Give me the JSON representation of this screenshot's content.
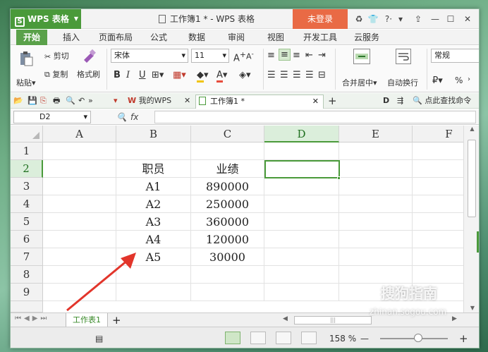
{
  "app": {
    "logo_label": "WPS 表格",
    "window_title": "工作簿1 * - WPS 表格",
    "login_label": "未登录"
  },
  "ribbon_tabs": [
    "开始",
    "插入",
    "页面布局",
    "公式",
    "数据",
    "审阅",
    "视图",
    "开发工具",
    "云服务"
  ],
  "ribbon": {
    "paste": "粘贴",
    "cut": "剪切",
    "copy": "复制",
    "format_painter": "格式刷",
    "font_name": "宋体",
    "font_size": "11",
    "merge_center": "合并居中",
    "wrap_text": "自动换行",
    "number_format": "常规",
    "percent": "%"
  },
  "doc_tabs": {
    "my_wps": "我的WPS",
    "workbook": "工作簿1 *",
    "search": "点此查找命令"
  },
  "formula_bar": {
    "name_box": "D2",
    "fx": "fx"
  },
  "grid": {
    "columns": [
      "A",
      "B",
      "C",
      "D",
      "E",
      "F"
    ],
    "rows": [
      "1",
      "2",
      "3",
      "4",
      "5",
      "6",
      "7",
      "8",
      "9"
    ],
    "selected_column": "D",
    "selected_row": "2",
    "cells": {
      "B2": "职员",
      "C2": "业绩",
      "B3": "A1",
      "C3": "890000",
      "B4": "A2",
      "C4": "250000",
      "B5": "A3",
      "C5": "360000",
      "B6": "A4",
      "C6": "120000",
      "B7": "A5",
      "C7": "30000"
    }
  },
  "sheet_tabs": [
    "工作表1"
  ],
  "status": {
    "zoom": "158 %"
  },
  "watermark": {
    "text": "搜狗指南",
    "sub": "zhinan.sogou.com"
  },
  "colors": {
    "accent_green": "#4a9a3a",
    "login_orange": "#e96a45",
    "arrow_red": "#e2352b"
  }
}
